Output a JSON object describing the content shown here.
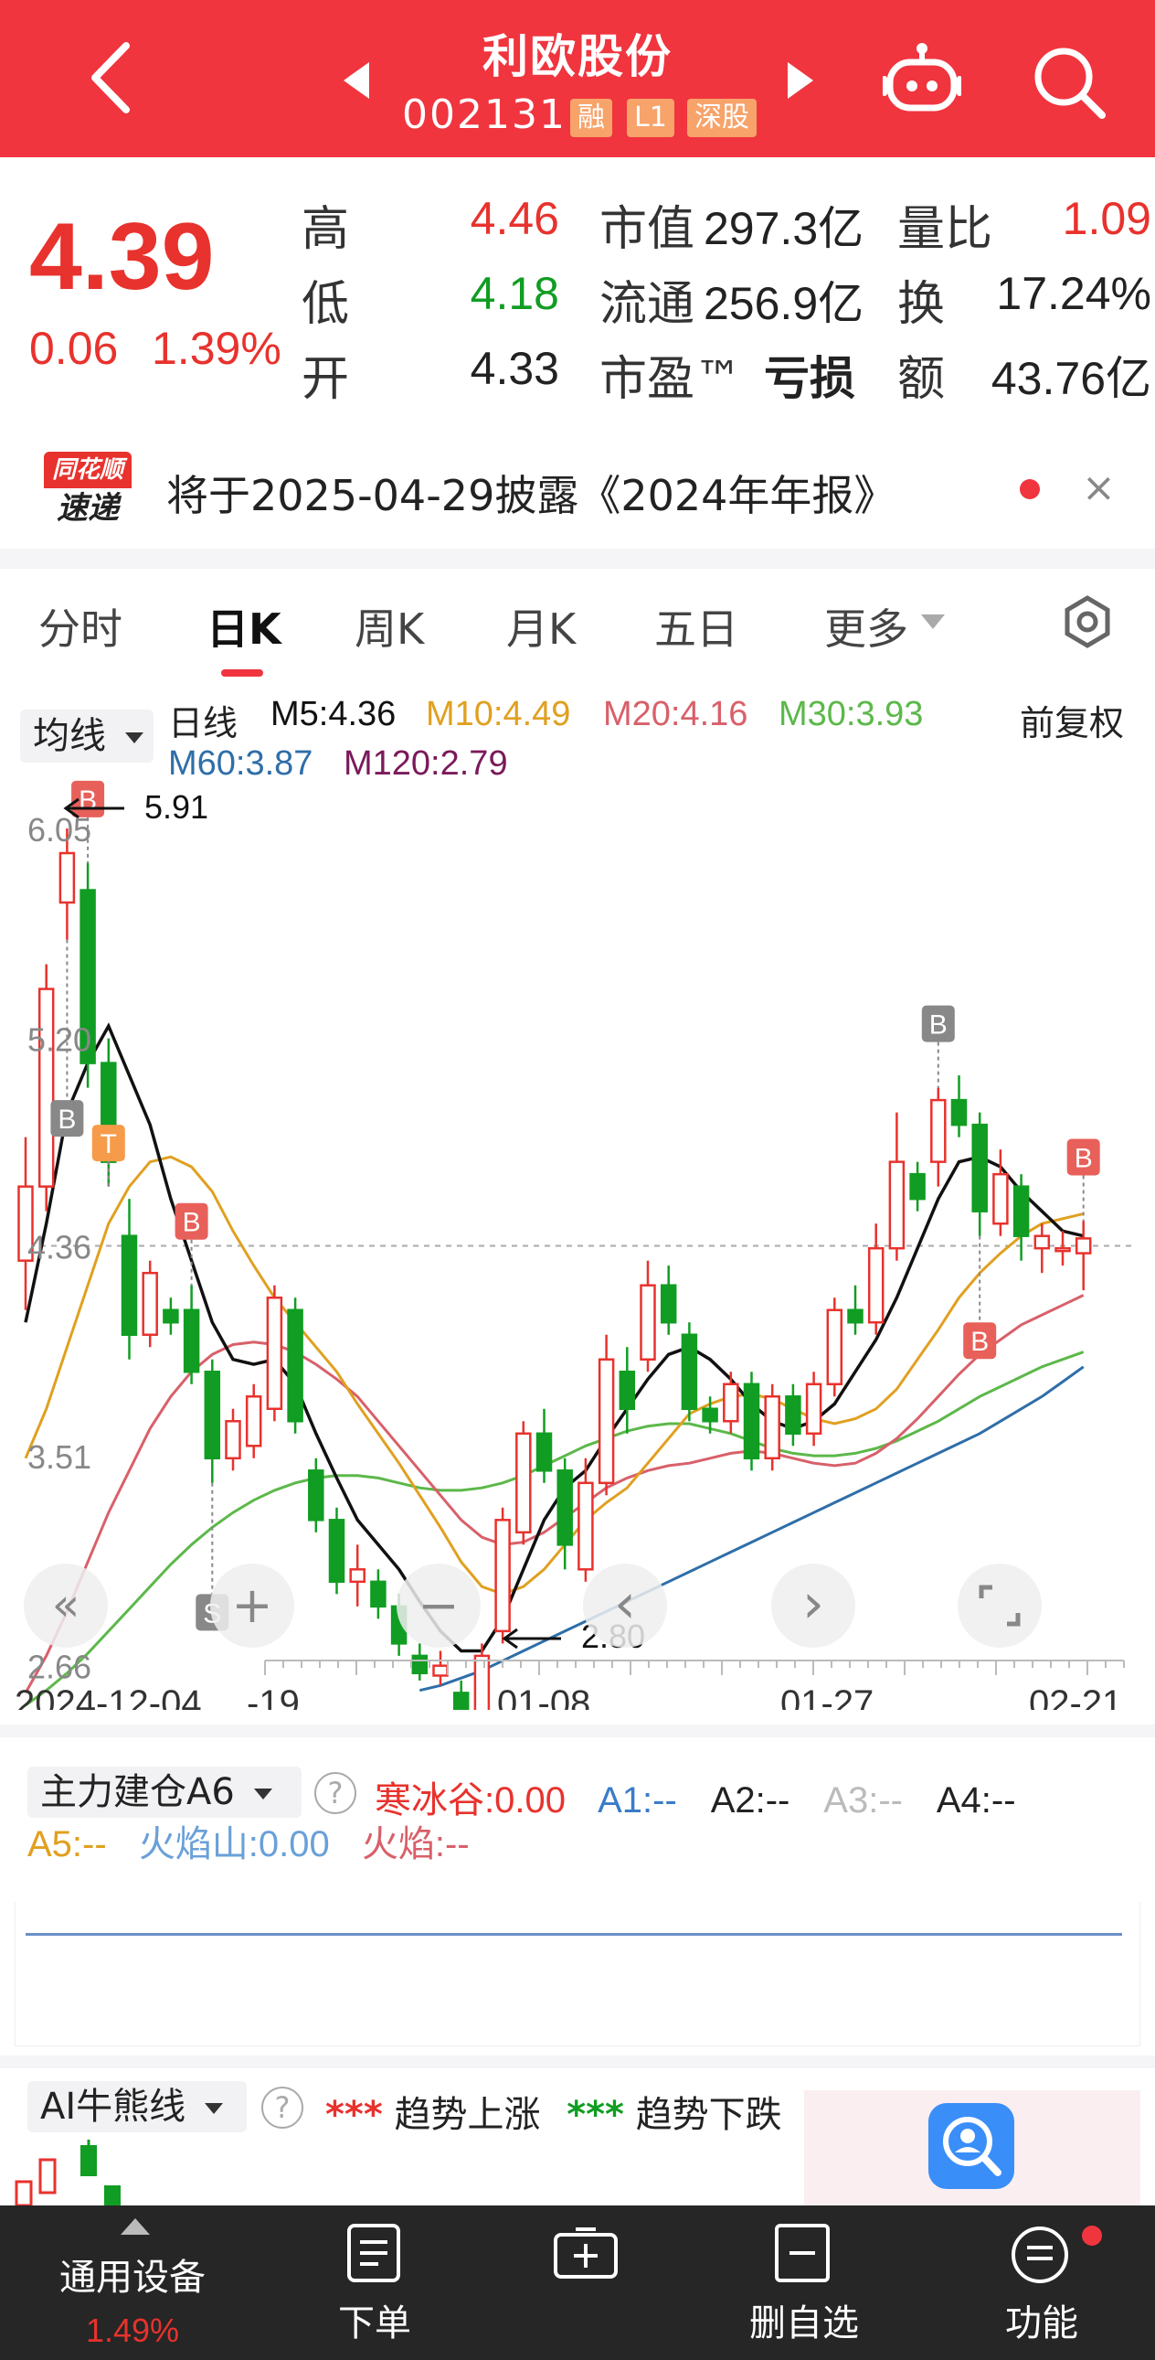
{
  "header": {
    "stock_name": "利欧股份",
    "stock_code": "002131",
    "tags": [
      "融",
      "L1",
      "深股"
    ]
  },
  "quote": {
    "price": "4.39",
    "change": "0.06",
    "change_pct": "1.39%",
    "rows": [
      {
        "label": "高",
        "value": "4.46",
        "m_label": "市值",
        "m_value": "297.3亿",
        "r_label": "量比",
        "r_value": "1.09"
      },
      {
        "label": "低",
        "value": "4.18",
        "m_label": "流通",
        "m_value": "256.9亿",
        "r_label": "换",
        "r_value": "17.24%"
      },
      {
        "label": "开",
        "value": "4.33",
        "m_label": "市盈™",
        "m_value": "亏损",
        "r_label": "额",
        "r_value": "43.76亿"
      }
    ]
  },
  "notice": {
    "logo_top": "同花顺",
    "logo_bottom": "速递",
    "text": "将于2025-04-29披露《2024年年报》",
    "close": "×"
  },
  "tabs": [
    "分时",
    "日K",
    "周K",
    "月K",
    "五日",
    "更多"
  ],
  "active_tab": "日K",
  "legend": {
    "select": "均线",
    "period": "日线",
    "m5": "M5:4.36",
    "m10": "M10:4.49",
    "m20": "M20:4.16",
    "m30": "M30:3.93",
    "m60": "M60:3.87",
    "m120": "M120:2.79",
    "adjust": "前复权"
  },
  "colors": {
    "up": "#e8322d",
    "down": "#119d23",
    "m5": "#111111",
    "m10": "#e0a020",
    "m20": "#d8606a",
    "m30": "#5cb84a",
    "m60": "#2f6ea8",
    "m120": "#7a1a5a"
  },
  "chart_data": {
    "type": "candlestick",
    "y_ticks": [
      "6.05",
      "5.20",
      "4.36",
      "3.51",
      "2.66"
    ],
    "x_ticks": [
      "2024-12-04",
      "-19",
      "01-08",
      "01-27",
      "02-21"
    ],
    "annotations": {
      "high_label": "5.91",
      "low_label": "2.80",
      "current_line": 4.36
    },
    "signals": [
      "B",
      "B",
      "T",
      "B",
      "S",
      "B",
      "B",
      "B"
    ],
    "candles": [
      {
        "o": 4.3,
        "c": 4.6,
        "h": 4.8,
        "l": 4.1
      },
      {
        "o": 4.6,
        "c": 5.4,
        "h": 5.5,
        "l": 4.5
      },
      {
        "o": 5.75,
        "c": 5.95,
        "h": 6.05,
        "l": 5.6
      },
      {
        "o": 5.8,
        "c": 5.1,
        "h": 5.91,
        "l": 5.0
      },
      {
        "o": 5.1,
        "c": 4.7,
        "h": 5.2,
        "l": 4.6
      },
      {
        "o": 4.4,
        "c": 4.0,
        "h": 4.55,
        "l": 3.9
      },
      {
        "o": 4.0,
        "c": 4.25,
        "h": 4.3,
        "l": 3.95
      },
      {
        "o": 4.1,
        "c": 4.05,
        "h": 4.15,
        "l": 4.0
      },
      {
        "o": 4.1,
        "c": 3.85,
        "h": 4.2,
        "l": 3.8
      },
      {
        "o": 3.85,
        "c": 3.5,
        "h": 3.9,
        "l": 3.4
      },
      {
        "o": 3.5,
        "c": 3.65,
        "h": 3.7,
        "l": 3.45
      },
      {
        "o": 3.55,
        "c": 3.75,
        "h": 3.8,
        "l": 3.5
      },
      {
        "o": 3.7,
        "c": 4.15,
        "h": 4.2,
        "l": 3.65
      },
      {
        "o": 4.1,
        "c": 3.65,
        "h": 4.15,
        "l": 3.6
      },
      {
        "o": 3.45,
        "c": 3.25,
        "h": 3.5,
        "l": 3.2
      },
      {
        "o": 3.25,
        "c": 3.0,
        "h": 3.3,
        "l": 2.95
      },
      {
        "o": 3.0,
        "c": 3.05,
        "h": 3.15,
        "l": 2.9
      },
      {
        "o": 3.0,
        "c": 2.9,
        "h": 3.05,
        "l": 2.85
      },
      {
        "o": 2.9,
        "c": 2.75,
        "h": 2.95,
        "l": 2.7
      },
      {
        "o": 2.7,
        "c": 2.63,
        "h": 2.75,
        "l": 2.6
      },
      {
        "o": 2.62,
        "c": 2.66,
        "h": 2.72,
        "l": 2.58
      },
      {
        "o": 2.55,
        "c": 2.45,
        "h": 2.6,
        "l": 2.4
      },
      {
        "o": 2.45,
        "c": 2.7,
        "h": 2.75,
        "l": 2.4
      },
      {
        "o": 2.8,
        "c": 3.25,
        "h": 3.3,
        "l": 2.75
      },
      {
        "o": 3.2,
        "c": 3.6,
        "h": 3.65,
        "l": 3.15
      },
      {
        "o": 3.6,
        "c": 3.45,
        "h": 3.7,
        "l": 3.4
      },
      {
        "o": 3.45,
        "c": 3.15,
        "h": 3.5,
        "l": 3.05
      },
      {
        "o": 3.05,
        "c": 3.4,
        "h": 3.5,
        "l": 3.0
      },
      {
        "o": 3.4,
        "c": 3.9,
        "h": 4.0,
        "l": 3.35
      },
      {
        "o": 3.85,
        "c": 3.7,
        "h": 3.95,
        "l": 3.6
      },
      {
        "o": 3.9,
        "c": 4.2,
        "h": 4.3,
        "l": 3.85
      },
      {
        "o": 4.2,
        "c": 4.05,
        "h": 4.28,
        "l": 4.0
      },
      {
        "o": 4.0,
        "c": 3.7,
        "h": 4.05,
        "l": 3.65
      },
      {
        "o": 3.7,
        "c": 3.65,
        "h": 3.75,
        "l": 3.6
      },
      {
        "o": 3.65,
        "c": 3.8,
        "h": 3.85,
        "l": 3.6
      },
      {
        "o": 3.8,
        "c": 3.5,
        "h": 3.85,
        "l": 3.45
      },
      {
        "o": 3.5,
        "c": 3.75,
        "h": 3.8,
        "l": 3.45
      },
      {
        "o": 3.75,
        "c": 3.6,
        "h": 3.8,
        "l": 3.55
      },
      {
        "o": 3.6,
        "c": 3.8,
        "h": 3.85,
        "l": 3.55
      },
      {
        "o": 3.8,
        "c": 4.1,
        "h": 4.15,
        "l": 3.75
      },
      {
        "o": 4.1,
        "c": 4.05,
        "h": 4.2,
        "l": 4.0
      },
      {
        "o": 4.05,
        "c": 4.35,
        "h": 4.45,
        "l": 4.0
      },
      {
        "o": 4.35,
        "c": 4.7,
        "h": 4.9,
        "l": 4.3
      },
      {
        "o": 4.65,
        "c": 4.55,
        "h": 4.7,
        "l": 4.5
      },
      {
        "o": 4.7,
        "c": 4.95,
        "h": 5.0,
        "l": 4.6
      },
      {
        "o": 4.95,
        "c": 4.85,
        "h": 5.05,
        "l": 4.8
      },
      {
        "o": 4.85,
        "c": 4.5,
        "h": 4.9,
        "l": 4.4
      },
      {
        "o": 4.45,
        "c": 4.65,
        "h": 4.75,
        "l": 4.4
      },
      {
        "o": 4.6,
        "c": 4.4,
        "h": 4.65,
        "l": 4.3
      },
      {
        "o": 4.35,
        "c": 4.4,
        "h": 4.45,
        "l": 4.25
      },
      {
        "o": 4.35,
        "c": 4.35,
        "h": 4.42,
        "l": 4.28
      },
      {
        "o": 4.33,
        "c": 4.39,
        "h": 4.46,
        "l": 4.18
      }
    ],
    "ma_series": {
      "m5": [
        4.05,
        4.45,
        4.9,
        5.1,
        5.25,
        5.05,
        4.85,
        4.55,
        4.3,
        4.05,
        3.9,
        3.88,
        3.9,
        3.8,
        3.6,
        3.42,
        3.25,
        3.15,
        3.05,
        2.92,
        2.8,
        2.72,
        2.72,
        2.85,
        3.05,
        3.25,
        3.38,
        3.45,
        3.58,
        3.7,
        3.82,
        3.92,
        3.95,
        3.9,
        3.82,
        3.72,
        3.65,
        3.62,
        3.65,
        3.72,
        3.85,
        3.98,
        4.15,
        4.35,
        4.55,
        4.7,
        4.72,
        4.68,
        4.58,
        4.5,
        4.42,
        4.4
      ],
      "m10": [
        3.5,
        3.7,
        3.95,
        4.2,
        4.45,
        4.6,
        4.7,
        4.72,
        4.68,
        4.58,
        4.42,
        4.28,
        4.15,
        4.05,
        3.95,
        3.85,
        3.72,
        3.6,
        3.48,
        3.35,
        3.22,
        3.08,
        2.98,
        2.95,
        2.98,
        3.05,
        3.15,
        3.25,
        3.32,
        3.38,
        3.48,
        3.58,
        3.68,
        3.72,
        3.75,
        3.76,
        3.74,
        3.7,
        3.66,
        3.64,
        3.66,
        3.7,
        3.78,
        3.9,
        4.02,
        4.15,
        4.25,
        4.33,
        4.4,
        4.45,
        4.47,
        4.49
      ],
      "m20": [
        2.55,
        2.7,
        2.88,
        3.08,
        3.28,
        3.45,
        3.62,
        3.75,
        3.85,
        3.92,
        3.96,
        3.97,
        3.96,
        3.93,
        3.88,
        3.82,
        3.75,
        3.65,
        3.55,
        3.45,
        3.35,
        3.25,
        3.18,
        3.15,
        3.16,
        3.2,
        3.26,
        3.32,
        3.38,
        3.42,
        3.45,
        3.47,
        3.48,
        3.5,
        3.52,
        3.53,
        3.52,
        3.5,
        3.48,
        3.47,
        3.48,
        3.52,
        3.58,
        3.66,
        3.75,
        3.84,
        3.92,
        3.98,
        4.04,
        4.08,
        4.12,
        4.16
      ],
      "m30": [
        2.5,
        2.56,
        2.63,
        2.71,
        2.8,
        2.89,
        2.98,
        3.07,
        3.15,
        3.22,
        3.28,
        3.33,
        3.37,
        3.4,
        3.42,
        3.43,
        3.43,
        3.42,
        3.4,
        3.38,
        3.37,
        3.37,
        3.38,
        3.4,
        3.43,
        3.47,
        3.51,
        3.55,
        3.58,
        3.61,
        3.63,
        3.64,
        3.64,
        3.62,
        3.6,
        3.57,
        3.54,
        3.52,
        3.51,
        3.51,
        3.52,
        3.54,
        3.57,
        3.61,
        3.65,
        3.7,
        3.75,
        3.79,
        3.83,
        3.87,
        3.9,
        3.93
      ],
      "m60": [
        null,
        null,
        null,
        null,
        null,
        null,
        null,
        null,
        null,
        null,
        null,
        null,
        null,
        null,
        null,
        null,
        null,
        null,
        null,
        2.56,
        2.58,
        2.61,
        2.64,
        2.68,
        2.72,
        2.76,
        2.8,
        2.84,
        2.88,
        2.92,
        2.96,
        3.0,
        3.04,
        3.08,
        3.12,
        3.16,
        3.2,
        3.24,
        3.28,
        3.32,
        3.36,
        3.4,
        3.44,
        3.48,
        3.52,
        3.56,
        3.6,
        3.65,
        3.7,
        3.75,
        3.81,
        3.87
      ],
      "m120": []
    }
  },
  "chart_controls": {
    "rewind": "«",
    "zoom_in": "+",
    "zoom_out": "−",
    "prev": "‹",
    "next": "›"
  },
  "indicator": {
    "select": "主力建仓A6",
    "help": "?",
    "items": [
      {
        "label": "寒冰谷:0.00",
        "color": "#e8322d"
      },
      {
        "label": "A1:--",
        "color": "#3a7cc8"
      },
      {
        "label": "A2:--",
        "color": "#222222"
      },
      {
        "label": "A3:--",
        "color": "#bbbbbb"
      },
      {
        "label": "A4:--",
        "color": "#222222"
      }
    ],
    "items2": [
      {
        "label": "A5:--",
        "color": "#e0a020"
      },
      {
        "label": "火焰山:0.00",
        "color": "#6aa0d8"
      },
      {
        "label": "火焰:--",
        "color": "#d8606a"
      }
    ]
  },
  "ai": {
    "select": "AI牛熊线",
    "help": "?",
    "up_dots": "***",
    "up_text": "趋势上涨",
    "down_dots": "***",
    "down_text": "趋势下跌"
  },
  "bottom_bar": {
    "items": [
      {
        "label": "通用设备",
        "sub": "1.49%"
      },
      {
        "label": "下单"
      },
      {
        "label": ""
      },
      {
        "label": "删自选"
      },
      {
        "label": "功能"
      }
    ]
  }
}
